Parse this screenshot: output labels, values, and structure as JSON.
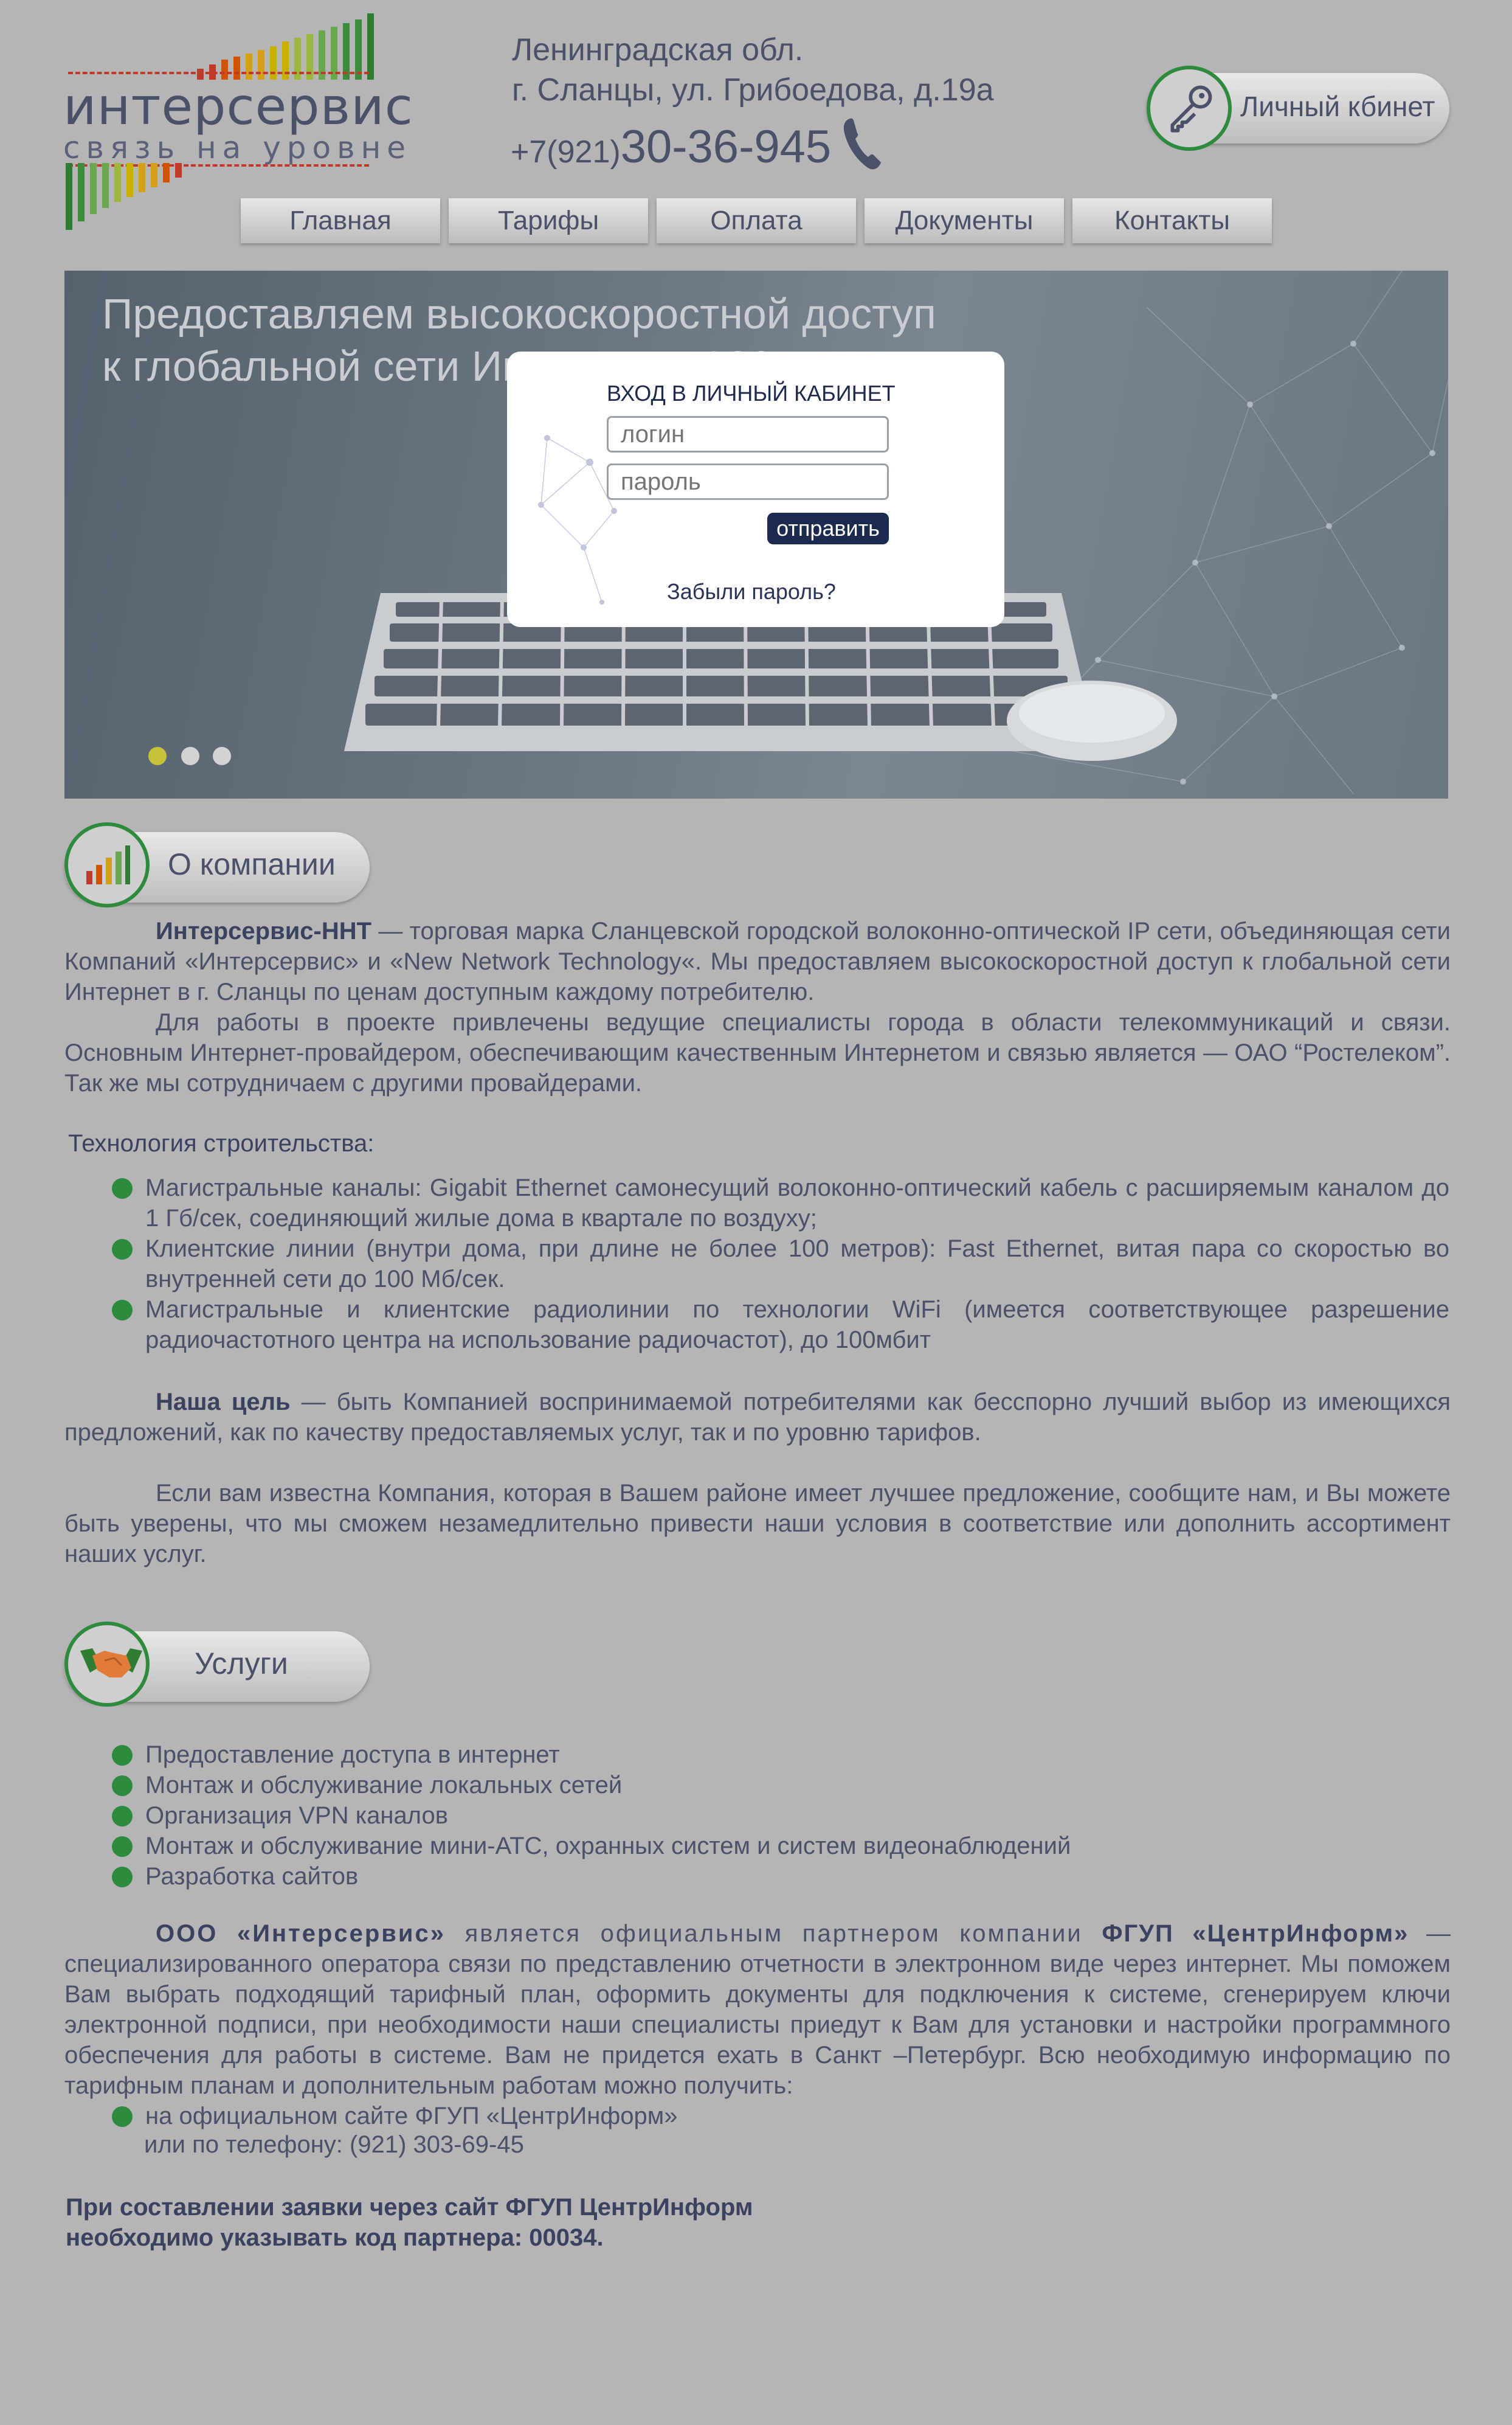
{
  "logo": {
    "title": "интерсервис",
    "subtitle": "связь на уровне"
  },
  "contacts": {
    "address_line1": "Ленинградская обл.",
    "address_line2": "г. Сланцы, ул. Грибоедова, д.19а",
    "phone_prefix": "+7(921)",
    "phone_number": "30-36-945"
  },
  "cabinet_button": {
    "label": "Личный кбинет"
  },
  "nav": [
    {
      "label": "Главная"
    },
    {
      "label": "Тарифы"
    },
    {
      "label": "Оплата"
    },
    {
      "label": "Документы"
    },
    {
      "label": "Контакты"
    }
  ],
  "banner": {
    "line1": "Предоставляем высокоскоростной доступ",
    "line2": "к глобальной сети Интернет с 2007 года!",
    "dots": [
      "#c8c23a",
      "#d3d3d3",
      "#d3d3d3"
    ]
  },
  "login": {
    "title": "ВХОД В ЛИЧНЫЙ КАБИНЕТ",
    "login_placeholder": "логин",
    "password_placeholder": "пароль",
    "submit": "отправить",
    "forgot": "Забыли пароль?"
  },
  "about": {
    "title": "О компании",
    "p1_bold": "Интерсервис-ННТ",
    "p1": " — торговая марка Сланцевской городской волоконно-оптической IP сети, объединяющая сети Компаний «Интерсервис» и «New Network Technology«. Мы предоставляем высокоскоростной доступ к глобальной сети Интернет в г. Сланцы по ценам доступным каждому потребителю.",
    "p2": "Для работы в проекте привлечены ведущие специалисты города в области телекоммуникаций и связи. Основным Интернет-провайдером, обеспечивающим качественным Интернетом и связью является — ОАО “Ростелеком”. Так же мы сотрудничаем с другими провайдерами.",
    "tech_title": "Технология строительства:",
    "tech": [
      "Магистральные каналы: Gigabit Ethernet самонесущий волоконно-оптический кабель с расширяемым каналом до 1 Гб/сек, соединяющий жилые дома в квартале по воздуху;",
      "Клиентские линии (внутри дома, при длине не более 100 метров): Fast Ethernet, витая пара со скоростью во внутренней сети до 100 Мб/сек.",
      "Магистральные и клиентские радиолинии по технологии WiFi (имеется соответствующее разрешение радиочастотного центра на использование радиочастот), до 100мбит"
    ],
    "goal_bold": "Наша цель",
    "goal": " — быть Компанией воспринимаемой потребителями как бесспорно лучший выбор из имеющихся предложений, как по качеству предоставляемых услуг, так и по уровню тарифов.",
    "p4": "Если вам известна Компания, которая в Вашем районе имеет лучшее предложение, сообщите нам, и Вы можете быть уверены, что мы сможем незамедлительно привести наши условия в соответствие или дополнить ассортимент наших услуг."
  },
  "services": {
    "title": "Услуги",
    "items": [
      "Предоставление доступа в интернет",
      "Монтаж и обслуживание локальных сетей",
      "Организация VPN каналов",
      "Монтаж и обслуживание мини-АТС, охранных систем и систем видеонаблюдений",
      "Разработка сайтов"
    ],
    "partner_bold1": "ООО «Интерсервис»",
    "partner_mid": " является официальным партнером компании ",
    "partner_bold2": "ФГУП «ЦентрИнформ»",
    "partner_rest": " — специализированного оператора связи по представлению отчетности в электронном виде через интернет. Мы поможем Вам выбрать подходящий тарифный план, оформить документы для подключения к системе, сгенерируем ключи электронной подписи, при необходимости наши специалисты приедут к Вам для установки и настройки программного обеспечения для работы в системе. Вам не придется ехать в Санкт –Петербург. Всю необходимую информацию по тарифным планам и дополнительным работам можно получить:",
    "source1": "на официальном сайте ФГУП «ЦентрИнформ»",
    "source2": "или по телефону: (921) 303-69-45",
    "note_line1": "При составлении заявки через сайт ФГУП ЦентрИнформ",
    "note_line2": "необходимо указывать код партнера: 00034."
  },
  "colors": {
    "accent_green": "#2e8a3c",
    "dark_navy": "#1c2a4f",
    "page_bg": "#b5b5b5"
  }
}
